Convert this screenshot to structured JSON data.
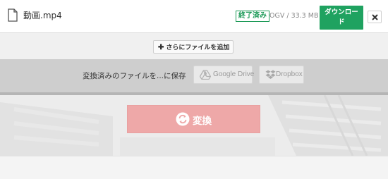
{
  "file": {
    "name": "動画.mp4",
    "status": "終了済み",
    "meta": "OGV / 33.3 MB",
    "download_label": "ダウンロード"
  },
  "actions": {
    "add_files_label": "さらにファイルを追加",
    "save_to_label": "変換済みのファイルを...に保存",
    "google_drive_label": "Google Drive",
    "dropbox_label": "Dropbox",
    "convert_label": "変換"
  },
  "icons": {
    "file": "file-icon",
    "close": "close-icon",
    "plus": "plus-icon",
    "google_drive": "google-drive-icon",
    "dropbox": "dropbox-icon",
    "convert": "convert-icon"
  },
  "colors": {
    "status_green": "#1d9a58",
    "download_green": "#1fa260",
    "convert_disabled": "#eea8a8",
    "save_bar": "#cecece"
  }
}
